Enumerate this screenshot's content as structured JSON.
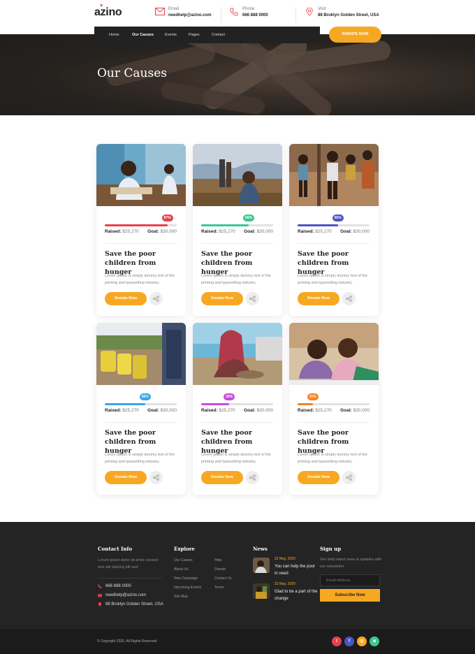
{
  "header": {
    "logo": "azino",
    "email_label": "Email",
    "email_value": "needhelp@azino.com",
    "phone_label": "Phone",
    "phone_value": "666 888 0000",
    "visit_label": "Visit",
    "visit_value": "88 Broklyn Golden Street, USA",
    "nav": [
      "Home",
      "Our Causes",
      "Events",
      "Pages",
      "Contact"
    ],
    "active_nav": "Our Causes",
    "donate_label": "DONATE NOW"
  },
  "banner": {
    "title": "Our Causes"
  },
  "causes": [
    {
      "percent": "87%",
      "percent_value": 87,
      "color": "#e8414b",
      "raised_label": "Raised:",
      "raised": "$25,270",
      "goal_label": "Goal:",
      "goal": "$30,000",
      "title": "Save the poor children from hunger",
      "desc": "Lorem Ipsum is simply dummy text of the printing and typesetting industry.",
      "button": "Donate Now"
    },
    {
      "percent": "66%",
      "percent_value": 66,
      "color": "#3cc88f",
      "raised_label": "Raised:",
      "raised": "$25,270",
      "goal_label": "Goal:",
      "goal": "$30,000",
      "title": "Save the poor children from hunger",
      "desc": "Lorem Ipsum is simply dummy text of the printing and typesetting industry.",
      "button": "Donate Now"
    },
    {
      "percent": "56%",
      "percent_value": 56,
      "color": "#4b55c4",
      "raised_label": "Raised:",
      "raised": "$25,270",
      "goal_label": "Goal:",
      "goal": "$30,000",
      "title": "Save the poor children from hunger",
      "desc": "Lorem Ipsum is simply dummy text of the printing and typesetting industry.",
      "button": "Donate Now"
    },
    {
      "percent": "56%",
      "percent_value": 56,
      "color": "#3aa6e8",
      "raised_label": "Raised:",
      "raised": "$25,270",
      "goal_label": "Goal:",
      "goal": "$30,000",
      "title": "Save the poor children from hunger",
      "desc": "Lorem Ipsum is simply dummy text of the printing and typesetting industry.",
      "button": "Donate Now"
    },
    {
      "percent": "39%",
      "percent_value": 39,
      "color": "#c84be0",
      "raised_label": "Raised:",
      "raised": "$25,270",
      "goal_label": "Goal:",
      "goal": "$30,000",
      "title": "Save the poor children from hunger",
      "desc": "Lorem Ipsum is simply dummy text of the printing and typesetting industry.",
      "button": "Donate Now"
    },
    {
      "percent": "21%",
      "percent_value": 21,
      "color": "#f5821f",
      "raised_label": "Raised:",
      "raised": "$25,270",
      "goal_label": "Goal:",
      "goal": "$30,000",
      "title": "Save the poor children from hunger",
      "desc": "Lorem Ipsum is simply dummy text of the printing and typesetting industry.",
      "button": "Donate Now"
    }
  ],
  "footer": {
    "contact_heading": "Contact Info",
    "contact_text": "Lorem ipsum dolor sit amet consect etur adi pisicing elit sed.",
    "phone": "666 888 0000",
    "email": "needhelp@azino.com",
    "address": "88 Broklyn Golden Street, USA",
    "explore_heading": "Explore",
    "explore_col1": [
      "Our Causes",
      "About Us",
      "New Campaign",
      "Upcoming Events",
      "Site Map"
    ],
    "explore_col2": [
      "Help",
      "Donate",
      "Contact Us",
      "Terms"
    ],
    "news_heading": "News",
    "news": [
      {
        "date": "22 May, 2020",
        "title": "You can help the poor in need"
      },
      {
        "date": "22 May, 2020",
        "title": "Glad to be a part of the change"
      }
    ],
    "signup_heading": "Sign up",
    "signup_text": "Get daily latest news & updates with our newsletter",
    "email_placeholder": "Email Address",
    "subscribe_label": "Subscribe Now",
    "copyright": "© Copyright 2020.  All Rights Reserved",
    "social": [
      {
        "icon": "twitter-icon",
        "glyph": "t",
        "color": "#e8414b"
      },
      {
        "icon": "facebook-icon",
        "glyph": "f",
        "color": "#4b55c4"
      },
      {
        "icon": "dribbble-icon",
        "glyph": "◎",
        "color": "#f7a823"
      },
      {
        "icon": "instagram-icon",
        "glyph": "◙",
        "color": "#3cc88f"
      }
    ]
  }
}
